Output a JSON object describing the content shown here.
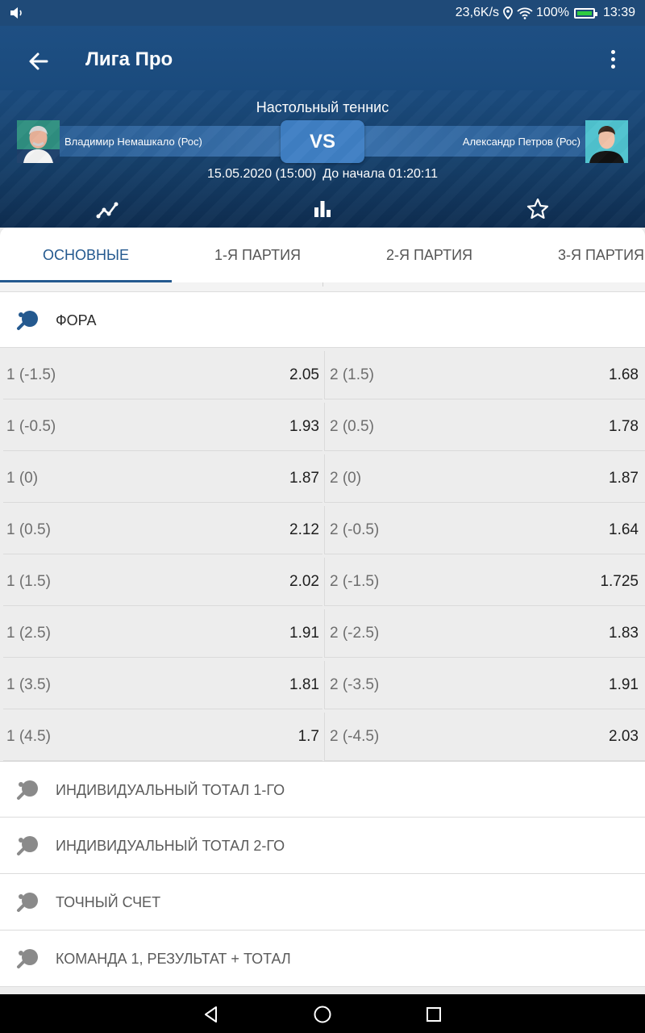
{
  "status_bar": {
    "network_speed": "23,6K/s",
    "battery_percent": "100%",
    "time": "13:39"
  },
  "header": {
    "title": "Лига Про",
    "sport": "Настольный теннис",
    "team1": "Владимир Немашкало (Рос)",
    "team2": "Александр Петров (Рос)",
    "vs_label": "VS",
    "date": "15.05.2020 (15:00)",
    "countdown": "До начала 01:20:11"
  },
  "tabs": [
    {
      "label": "ОСНОВНЫЕ",
      "active": true
    },
    {
      "label": "1-Я ПАРТИЯ",
      "active": false
    },
    {
      "label": "2-Я ПАРТИЯ",
      "active": false
    },
    {
      "label": "3-Я ПАРТИЯ",
      "active": false
    }
  ],
  "markets": {
    "open": {
      "title": "ФОРА",
      "rows": [
        {
          "left": {
            "label": "1 (-1.5)",
            "odd": "2.05"
          },
          "right": {
            "label": "2 (1.5)",
            "odd": "1.68"
          }
        },
        {
          "left": {
            "label": "1 (-0.5)",
            "odd": "1.93"
          },
          "right": {
            "label": "2 (0.5)",
            "odd": "1.78"
          }
        },
        {
          "left": {
            "label": "1 (0)",
            "odd": "1.87"
          },
          "right": {
            "label": "2 (0)",
            "odd": "1.87"
          }
        },
        {
          "left": {
            "label": "1 (0.5)",
            "odd": "2.12"
          },
          "right": {
            "label": "2 (-0.5)",
            "odd": "1.64"
          }
        },
        {
          "left": {
            "label": "1 (1.5)",
            "odd": "2.02"
          },
          "right": {
            "label": "2 (-1.5)",
            "odd": "1.725"
          }
        },
        {
          "left": {
            "label": "1 (2.5)",
            "odd": "1.91"
          },
          "right": {
            "label": "2 (-2.5)",
            "odd": "1.83"
          }
        },
        {
          "left": {
            "label": "1 (3.5)",
            "odd": "1.81"
          },
          "right": {
            "label": "2 (-3.5)",
            "odd": "1.91"
          }
        },
        {
          "left": {
            "label": "1 (4.5)",
            "odd": "1.7"
          },
          "right": {
            "label": "2 (-4.5)",
            "odd": "2.03"
          }
        }
      ]
    },
    "collapsed": [
      "ИНДИВИДУАЛЬНЫЙ ТОТАЛ 1-ГО",
      "ИНДИВИДУАЛЬНЫЙ ТОТАЛ 2-ГО",
      "ТОЧНЫЙ СЧЕТ",
      "КОМАНДА 1, РЕЗУЛЬТАТ + ТОТАЛ"
    ]
  },
  "colors": {
    "header_blue": "#1a4a7c",
    "accent": "#24598f",
    "vs_button": "#3f7fc4"
  }
}
